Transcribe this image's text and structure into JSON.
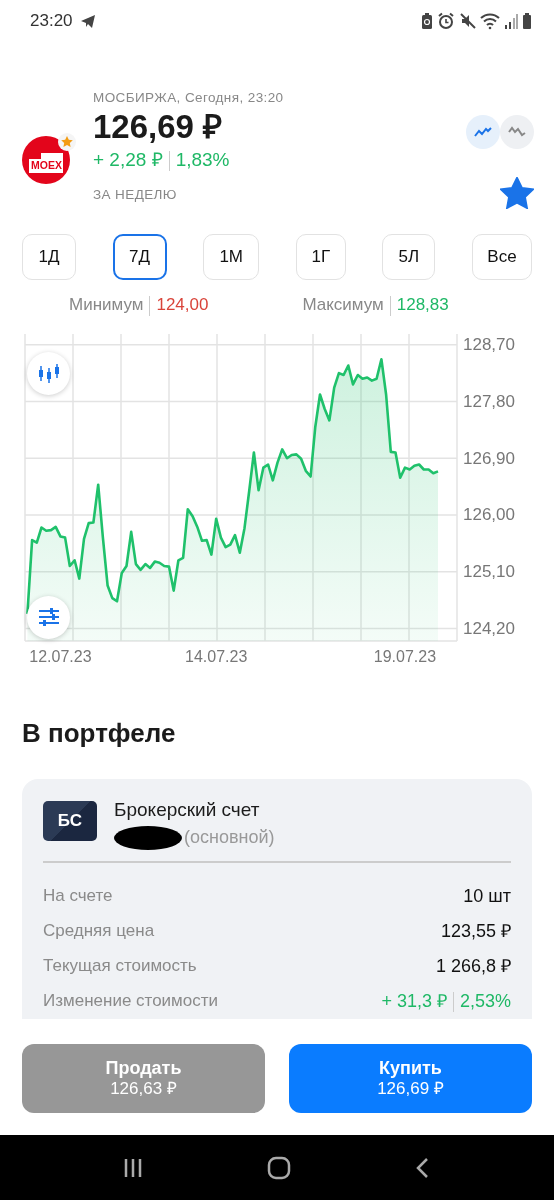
{
  "status_bar": {
    "time": "23:20"
  },
  "quote": {
    "exchange_line": "МОСБИРЖА, Сегодня, 23:20",
    "logo_text": "MOEX",
    "price": "126,69 ₽",
    "change_abs": "+ 2,28 ₽",
    "change_pct": "1,83%",
    "period_label": "ЗА НЕДЕЛЮ",
    "favorite": true,
    "chart_styles": [
      {
        "kind": "line",
        "selected": true
      },
      {
        "kind": "bars",
        "selected": false
      }
    ]
  },
  "periods": [
    {
      "label": "1Д",
      "selected": false
    },
    {
      "label": "7Д",
      "selected": true
    },
    {
      "label": "1М",
      "selected": false
    },
    {
      "label": "1Г",
      "selected": false
    },
    {
      "label": "5Л",
      "selected": false
    },
    {
      "label": "Все",
      "selected": false
    }
  ],
  "range": {
    "min_label": "Минимум",
    "min_value": "124,00",
    "max_label": "Максимум",
    "max_value": "128,83"
  },
  "chart": {
    "chart_data": {
      "type": "area",
      "grid": true,
      "ylim": [
        124.0,
        128.87
      ],
      "categories": [
        null,
        null,
        null,
        null,
        null,
        null,
        null,
        "12.07.23",
        null,
        null,
        null,
        null,
        null,
        null,
        null,
        null,
        null,
        null,
        null,
        null,
        null,
        null,
        null,
        null,
        null,
        null,
        null,
        null,
        null,
        null,
        null,
        null,
        null,
        null,
        null,
        null,
        null,
        null,
        null,
        null,
        "14.07.23",
        null,
        null,
        null,
        null,
        null,
        null,
        null,
        null,
        null,
        null,
        null,
        null,
        null,
        null,
        null,
        null,
        null,
        null,
        null,
        null,
        null,
        null,
        null,
        null,
        null,
        null,
        null,
        null,
        null,
        null,
        null,
        null,
        null,
        null,
        null,
        null,
        null,
        null,
        null,
        "19.07.23",
        null,
        null,
        null,
        null,
        null,
        null,
        null
      ],
      "yticks": [
        {
          "value": 124.2,
          "label": "124,20"
        },
        {
          "value": 125.1,
          "label": "125,10"
        },
        {
          "value": 126.0,
          "label": "126,00"
        },
        {
          "value": 126.9,
          "label": "126,90"
        },
        {
          "value": 127.8,
          "label": "127,80"
        },
        {
          "value": 128.7,
          "label": "128,70"
        }
      ],
      "series": [
        {
          "color": "#1fc16b",
          "values": [
            124.43,
            125.6,
            125.56,
            125.8,
            125.75,
            125.76,
            125.81,
            125.66,
            125.64,
            125.19,
            125.28,
            124.99,
            125.62,
            125.87,
            125.88,
            126.48,
            125.64,
            124.88,
            124.68,
            124.63,
            125.08,
            125.19,
            125.73,
            125.22,
            125.13,
            125.22,
            125.16,
            125.26,
            125.24,
            125.19,
            125.18,
            124.8,
            125.28,
            125.32,
            126.09,
            125.98,
            125.81,
            125.59,
            125.6,
            125.37,
            125.94,
            125.64,
            125.49,
            125.53,
            125.68,
            125.4,
            125.79,
            126.38,
            126.99,
            126.39,
            126.75,
            126.8,
            126.55,
            126.83,
            127.04,
            126.9,
            126.95,
            126.96,
            126.89,
            126.7,
            126.61,
            127.4,
            127.91,
            127.68,
            127.5,
            128.02,
            128.25,
            128.22,
            128.37,
            128.07,
            128.22,
            128.16,
            128.18,
            128.13,
            128.16,
            128.47,
            127.91,
            127.0,
            126.99,
            126.59,
            126.75,
            126.72,
            126.78,
            126.8,
            126.72,
            126.72,
            126.66,
            126.69
          ]
        }
      ]
    }
  },
  "portfolio": {
    "title": "В портфеле",
    "account": {
      "badge": "БС",
      "name": "Брокерский счет",
      "type": "(основной)"
    },
    "rows": [
      {
        "label": "На счете",
        "value": "10 шт",
        "kind": "plain"
      },
      {
        "label": "Средняя цена",
        "value": "123,55 ₽",
        "kind": "plain"
      },
      {
        "label": "Текущая стоимость",
        "value": "1 266,8 ₽",
        "kind": "plain"
      },
      {
        "label": "Изменение стоимости",
        "value": "+ 31,3 ₽",
        "extra": "2,53%",
        "kind": "change"
      }
    ]
  },
  "actions": [
    {
      "label": "Продать",
      "price": "126,63 ₽",
      "kind": "sell"
    },
    {
      "label": "Купить",
      "price": "126,69 ₽",
      "kind": "buy"
    }
  ]
}
